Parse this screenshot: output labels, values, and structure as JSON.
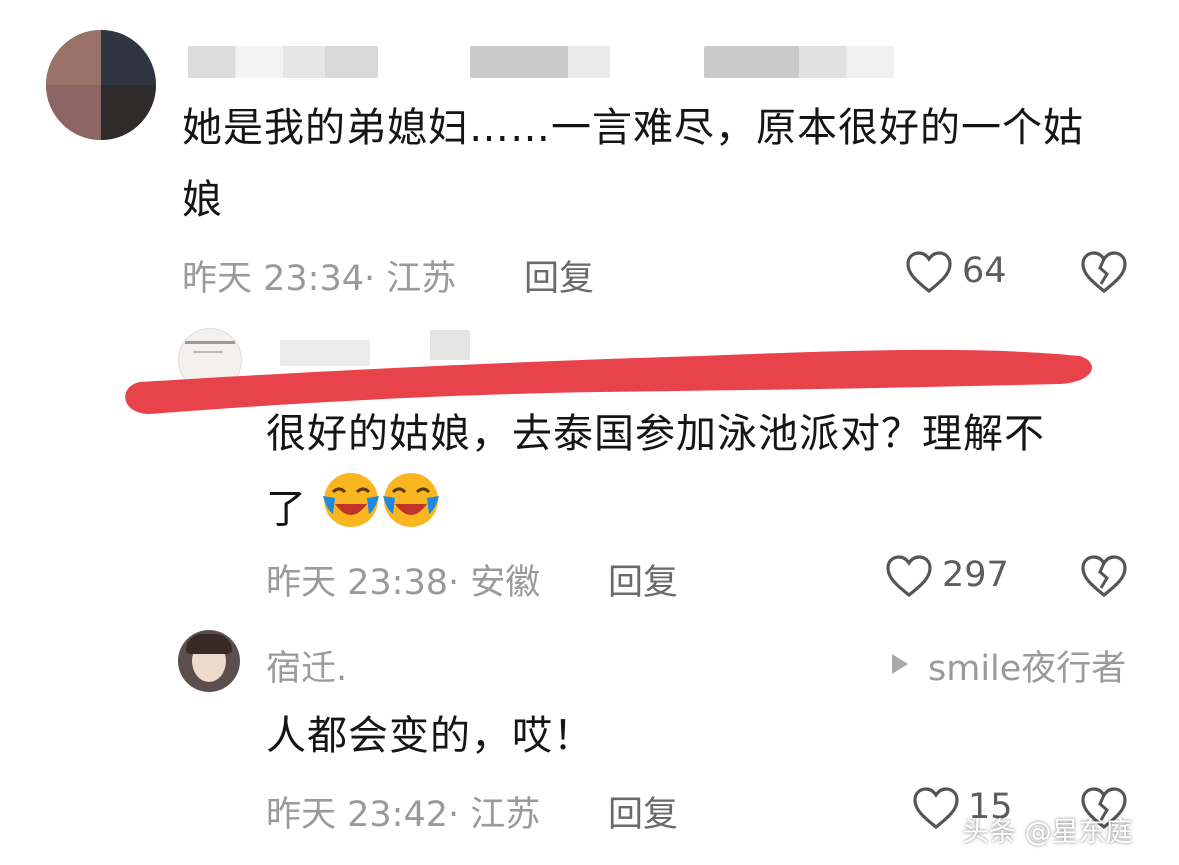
{
  "comments": [
    {
      "text_line1": "她是我的弟媳妇……一言难尽，原本很好的一个姑",
      "text_line2": "娘",
      "time_location": "昨天 23:34· 江苏",
      "reply_label": "回复",
      "like_count": "64"
    },
    {
      "text_line1": "很好的姑娘，去泰国参加泳池派对？理解不",
      "text_line2": "了",
      "emojis": [
        "crying-laughing-emoji",
        "crying-laughing-emoji"
      ],
      "time_location": "昨天 23:38· 安徽",
      "reply_label": "回复",
      "like_count": "297"
    },
    {
      "username": "宿迁.",
      "reply_to": "smile夜行者",
      "text": "人都会变的，哎！",
      "time_location": "昨天 23:42· 江苏",
      "reply_label": "回复",
      "like_count": "15"
    }
  ],
  "watermark": "头条 @星东庭",
  "colors": {
    "red_stroke": "#e8424a",
    "meta_gray": "#9a9a9a",
    "text": "#151515"
  }
}
